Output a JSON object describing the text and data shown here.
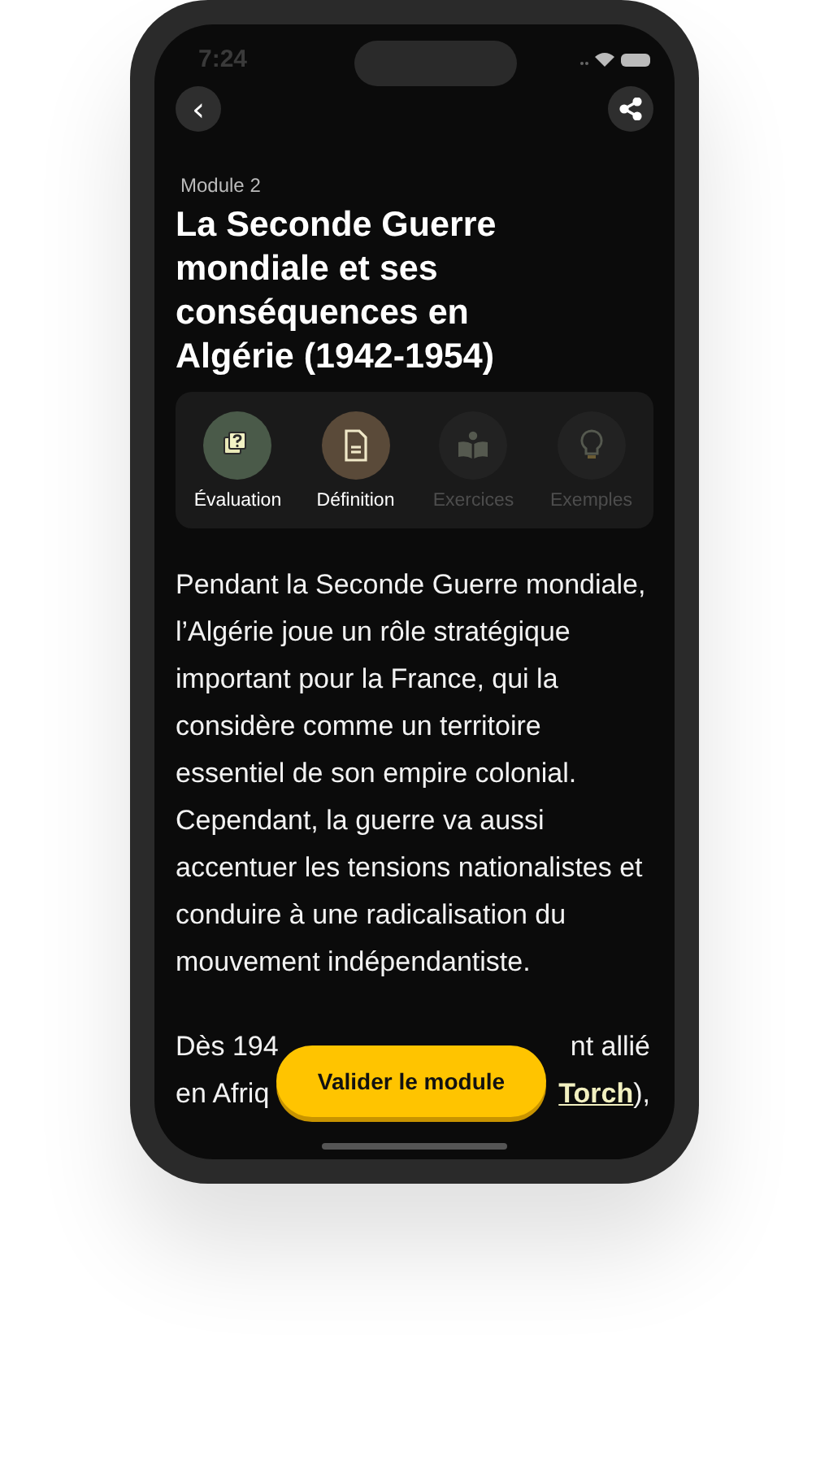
{
  "status_bar": {
    "time": "7:24"
  },
  "header": {
    "back": "‹",
    "module": "Module 2",
    "title": "La Seconde Guerre mondiale et ses conséquences en Algérie (1942-1954)"
  },
  "sections": [
    {
      "kind": "evaluation",
      "label": "Évaluation",
      "enabled": true,
      "color": "#4a5a49"
    },
    {
      "kind": "definition",
      "label": "Définition",
      "enabled": true,
      "color": "#5a4a39"
    },
    {
      "kind": "exercises",
      "label": "Exercices",
      "enabled": false,
      "color": "#222222"
    },
    {
      "kind": "examples",
      "label": "Exemples",
      "enabled": false,
      "color": "#222222"
    }
  ],
  "paragraph": "Pendant la Seconde Guerre mondiale, l’Algérie joue un rôle stratégique important pour la France, qui la considère comme un territoire essentiel de son empire colonial. Cependant, la guerre va aussi accentuer les tensions nationalistes et conduire à une radicalisation du mouvement indépendantiste.",
  "covered_lines": [
    {
      "left": "Dès 194",
      "right": "nt allié"
    },
    {
      "left": "en Afriq",
      "right_link": "Torch",
      "right": "),"
    }
  ],
  "button": "Valider le module"
}
